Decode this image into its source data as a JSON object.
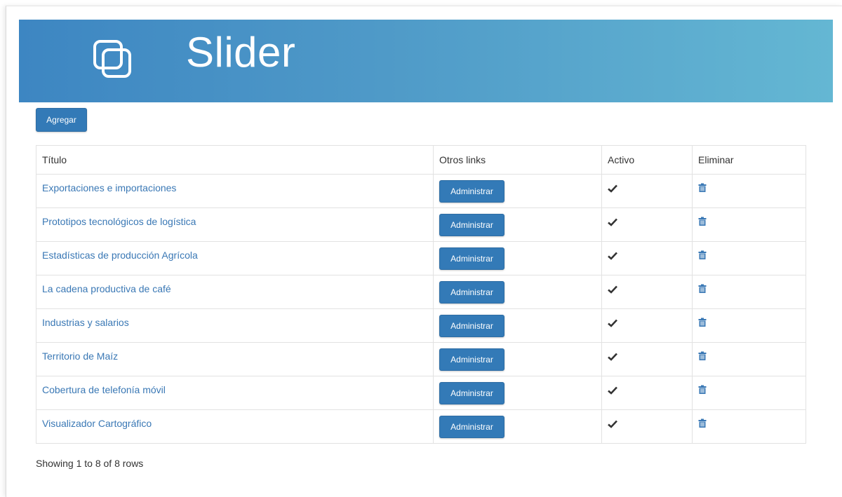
{
  "header": {
    "title": "Slider",
    "icon": "stacked-squares-icon"
  },
  "toolbar": {
    "add_label": "Agregar"
  },
  "table": {
    "columns": [
      "Título",
      "Otros links",
      "Activo",
      "Eliminar"
    ],
    "rows": [
      {
        "title": "Exportaciones e importaciones",
        "action": "Administrar"
      },
      {
        "title": "Prototipos tecnológicos de logística",
        "action": "Administrar"
      },
      {
        "title": "Estadísticas de producción Agrícola",
        "action": "Administrar"
      },
      {
        "title": "La cadena productiva de café",
        "action": "Administrar"
      },
      {
        "title": "Industrias y salarios",
        "action": "Administrar"
      },
      {
        "title": "Territorio de Maíz",
        "action": "Administrar"
      },
      {
        "title": "Cobertura de telefonía móvil",
        "action": "Administrar"
      },
      {
        "title": "Visualizador Cartográfico",
        "action": "Administrar"
      }
    ],
    "active_icon": "check-icon",
    "delete_icon": "trash-icon"
  },
  "pagination": {
    "info": "Showing 1 to 8 of 8 rows"
  },
  "colors": {
    "accent": "#337ab7",
    "banner_start": "#3d86c2",
    "banner_end": "#64b7d3",
    "link": "#3a78b5"
  }
}
